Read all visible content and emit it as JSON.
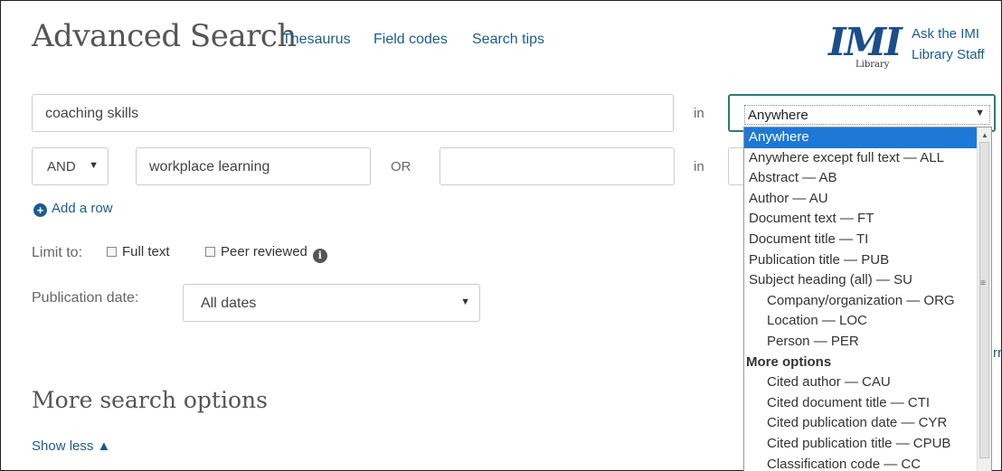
{
  "header": {
    "title": "Advanced Search",
    "links": [
      "Thesaurus",
      "Field codes",
      "Search tips"
    ],
    "logo_text": "IMI",
    "logo_sub": "Library",
    "ask_line1": "Ask the IMI",
    "ask_line2": "Library Staff"
  },
  "rows": [
    {
      "value": "coaching skills",
      "in_label": "in",
      "field": "Anywhere"
    },
    {
      "operator": "AND",
      "value": "workplace learning",
      "or_label": "OR",
      "value2": "",
      "in_label": "in"
    }
  ],
  "add_row": "Add a row",
  "limit": {
    "label": "Limit to:",
    "full_text": "Full text",
    "peer_reviewed": "Peer reviewed"
  },
  "pubdate": {
    "label": "Publication date:",
    "value": "All dates"
  },
  "more_options_title": "More search options",
  "show_less": "Show less ▲",
  "dropdown_options": [
    {
      "label": "Anywhere",
      "kind": "selected"
    },
    {
      "label": "Anywhere except full text — ALL",
      "kind": "opt"
    },
    {
      "label": "Abstract — AB",
      "kind": "opt"
    },
    {
      "label": "Author — AU",
      "kind": "opt"
    },
    {
      "label": "Document text — FT",
      "kind": "opt"
    },
    {
      "label": "Document title — TI",
      "kind": "opt"
    },
    {
      "label": "Publication title — PUB",
      "kind": "opt"
    },
    {
      "label": "Subject heading (all) — SU",
      "kind": "opt"
    },
    {
      "label": "Company/organization — ORG",
      "kind": "sub"
    },
    {
      "label": "Location — LOC",
      "kind": "sub"
    },
    {
      "label": "Person — PER",
      "kind": "sub"
    },
    {
      "label": "More options",
      "kind": "grp"
    },
    {
      "label": "Cited author — CAU",
      "kind": "sub"
    },
    {
      "label": "Cited document title — CTI",
      "kind": "sub"
    },
    {
      "label": "Cited publication date — CYR",
      "kind": "sub"
    },
    {
      "label": "Cited publication title — CPUB",
      "kind": "sub"
    },
    {
      "label": "Classification code — CC",
      "kind": "sub"
    }
  ],
  "clipped_link_fragment": "rr",
  "icons": {
    "add": "plus-circle-icon",
    "info": "info-icon",
    "dropdown": "chevron-down-icon"
  },
  "colors": {
    "link": "#1a5c8e",
    "focus_border": "#2b7a78",
    "option_selected": "#1e78d6"
  }
}
